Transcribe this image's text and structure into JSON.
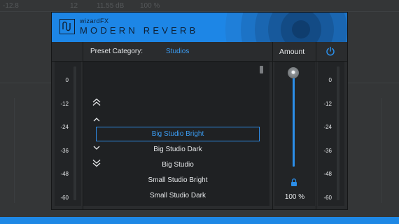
{
  "background": {
    "labels": [
      "-12.8",
      "12",
      "11.55 dB",
      "100 %"
    ]
  },
  "plugin": {
    "brand": "wizardFX",
    "product": "MODERN REVERB",
    "accent_color": "#1d86e6",
    "left_meter": {
      "scale": [
        "0",
        "-12",
        "-24",
        "-36",
        "-48",
        "-60"
      ]
    },
    "right_meter": {
      "scale": [
        "0",
        "-12",
        "-24",
        "-36",
        "-48",
        "-60"
      ]
    },
    "preset": {
      "label": "Preset Category:",
      "category": "Studios",
      "nav": {
        "first_icon": "double-chevron-up-icon",
        "prev_icon": "chevron-up-icon",
        "next_icon": "chevron-down-icon",
        "last_icon": "double-chevron-down-icon"
      },
      "items": [
        {
          "label": "Big Studio Bright",
          "selected": true
        },
        {
          "label": "Big Studio Dark",
          "selected": false
        },
        {
          "label": "Big Studio",
          "selected": false
        },
        {
          "label": "Small Studio Bright",
          "selected": false
        },
        {
          "label": "Small Studio Dark",
          "selected": false
        }
      ]
    },
    "amount": {
      "label": "Amount",
      "value": 1.0,
      "value_text": "100 %",
      "lock_icon": "lock-icon"
    },
    "power_icon": "power-icon"
  }
}
